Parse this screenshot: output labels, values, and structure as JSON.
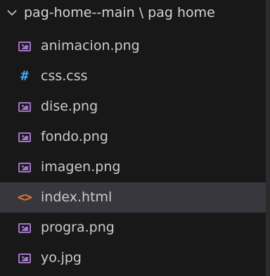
{
  "explorer": {
    "folder_path": "pag-home--main \\ pag home",
    "files": [
      {
        "label": "animacion.png",
        "icon": "image-file-icon"
      },
      {
        "label": "css.css",
        "icon": "css-file-icon"
      },
      {
        "label": "dise.png",
        "icon": "image-file-icon"
      },
      {
        "label": "fondo.png",
        "icon": "image-file-icon"
      },
      {
        "label": "imagen.png",
        "icon": "image-file-icon"
      },
      {
        "label": "index.html",
        "icon": "html-file-icon",
        "selected": true
      },
      {
        "label": "progra.png",
        "icon": "image-file-icon"
      },
      {
        "label": "yo.jpg",
        "icon": "image-file-icon"
      }
    ]
  },
  "colors": {
    "background": "#181818",
    "selected_row": "#37373d",
    "image_icon": "#a074c4",
    "css_icon": "#42a5f5",
    "html_icon": "#e37933",
    "text": "#cccccc"
  },
  "icons": {
    "css_glyph": "#",
    "html_glyph": "<>"
  }
}
